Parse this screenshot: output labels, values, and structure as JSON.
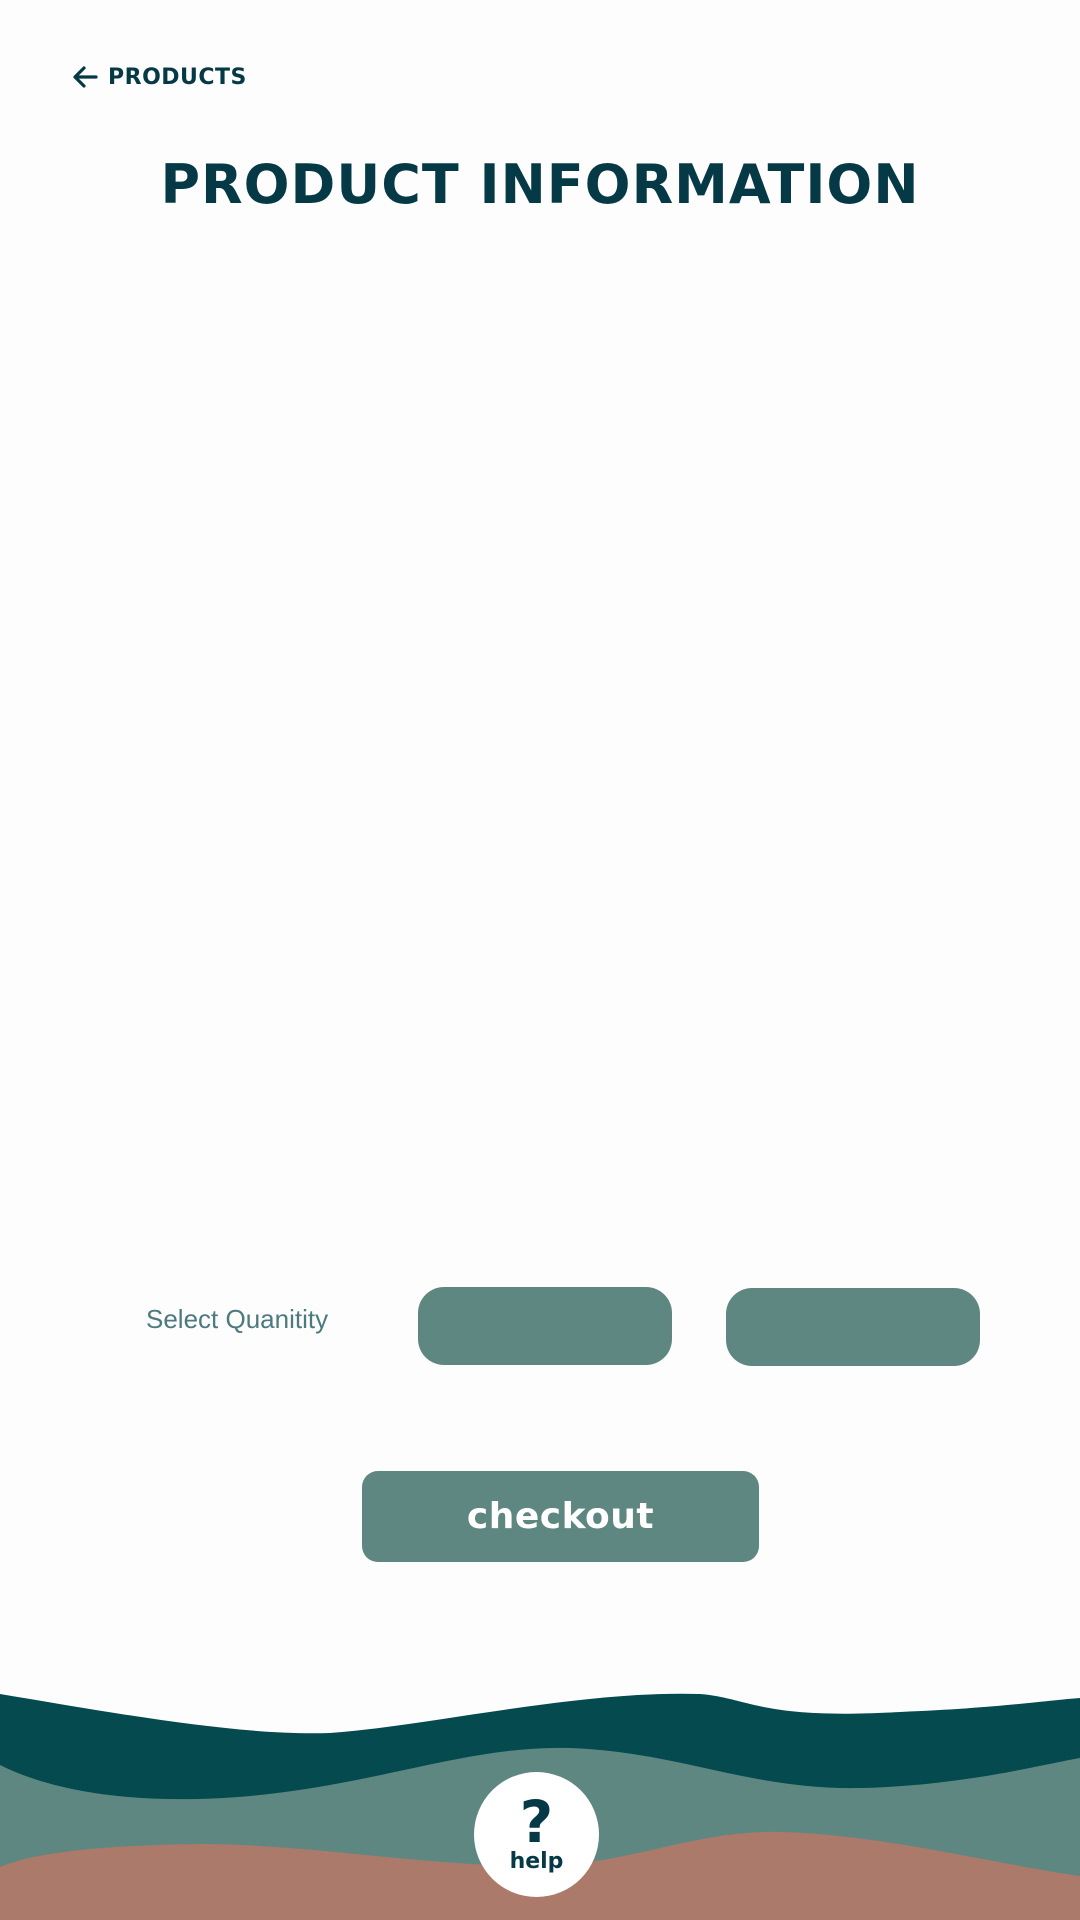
{
  "header": {
    "back_label": "PRODUCTS",
    "back_icon": "arrow-left-icon",
    "title": "PRODUCT INFORMATION"
  },
  "quantity": {
    "label": "Select Quanitity",
    "options": [
      "",
      ""
    ]
  },
  "checkout": {
    "label": "checkout"
  },
  "help": {
    "icon": "question-mark-icon",
    "icon_glyph": "?",
    "label": "help"
  },
  "colors": {
    "primary_dark": "#063946",
    "accent_teal": "#5e8781",
    "wave_dark": "#044a4f",
    "wave_mid": "#5e8781",
    "wave_clay": "#ab7a6a",
    "label_teal": "#4c7a7f",
    "background": "#fdfdfd"
  }
}
